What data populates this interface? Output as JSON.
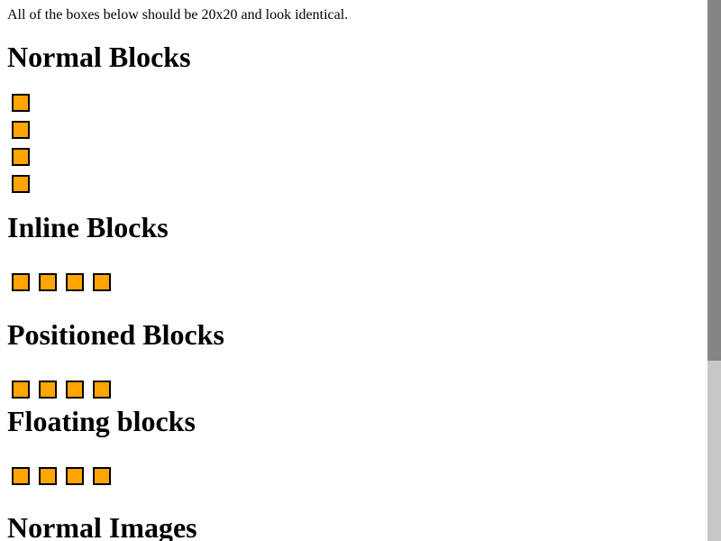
{
  "intro_text": "All of the boxes below should be 20x20 and look identical.",
  "sections": {
    "normal_blocks": {
      "title": "Normal Blocks",
      "box_count": 4
    },
    "inline_blocks": {
      "title": "Inline Blocks",
      "box_count": 4
    },
    "positioned_blocks": {
      "title": "Positioned Blocks",
      "box_count": 4
    },
    "floating_blocks": {
      "title": "Floating blocks",
      "box_count": 4
    },
    "normal_images": {
      "title": "Normal Images"
    }
  },
  "colors": {
    "box_fill": "#ffa500",
    "box_border": "#000000",
    "scrollbar_track": "#c8c8c8",
    "scrollbar_thumb": "#858585"
  }
}
